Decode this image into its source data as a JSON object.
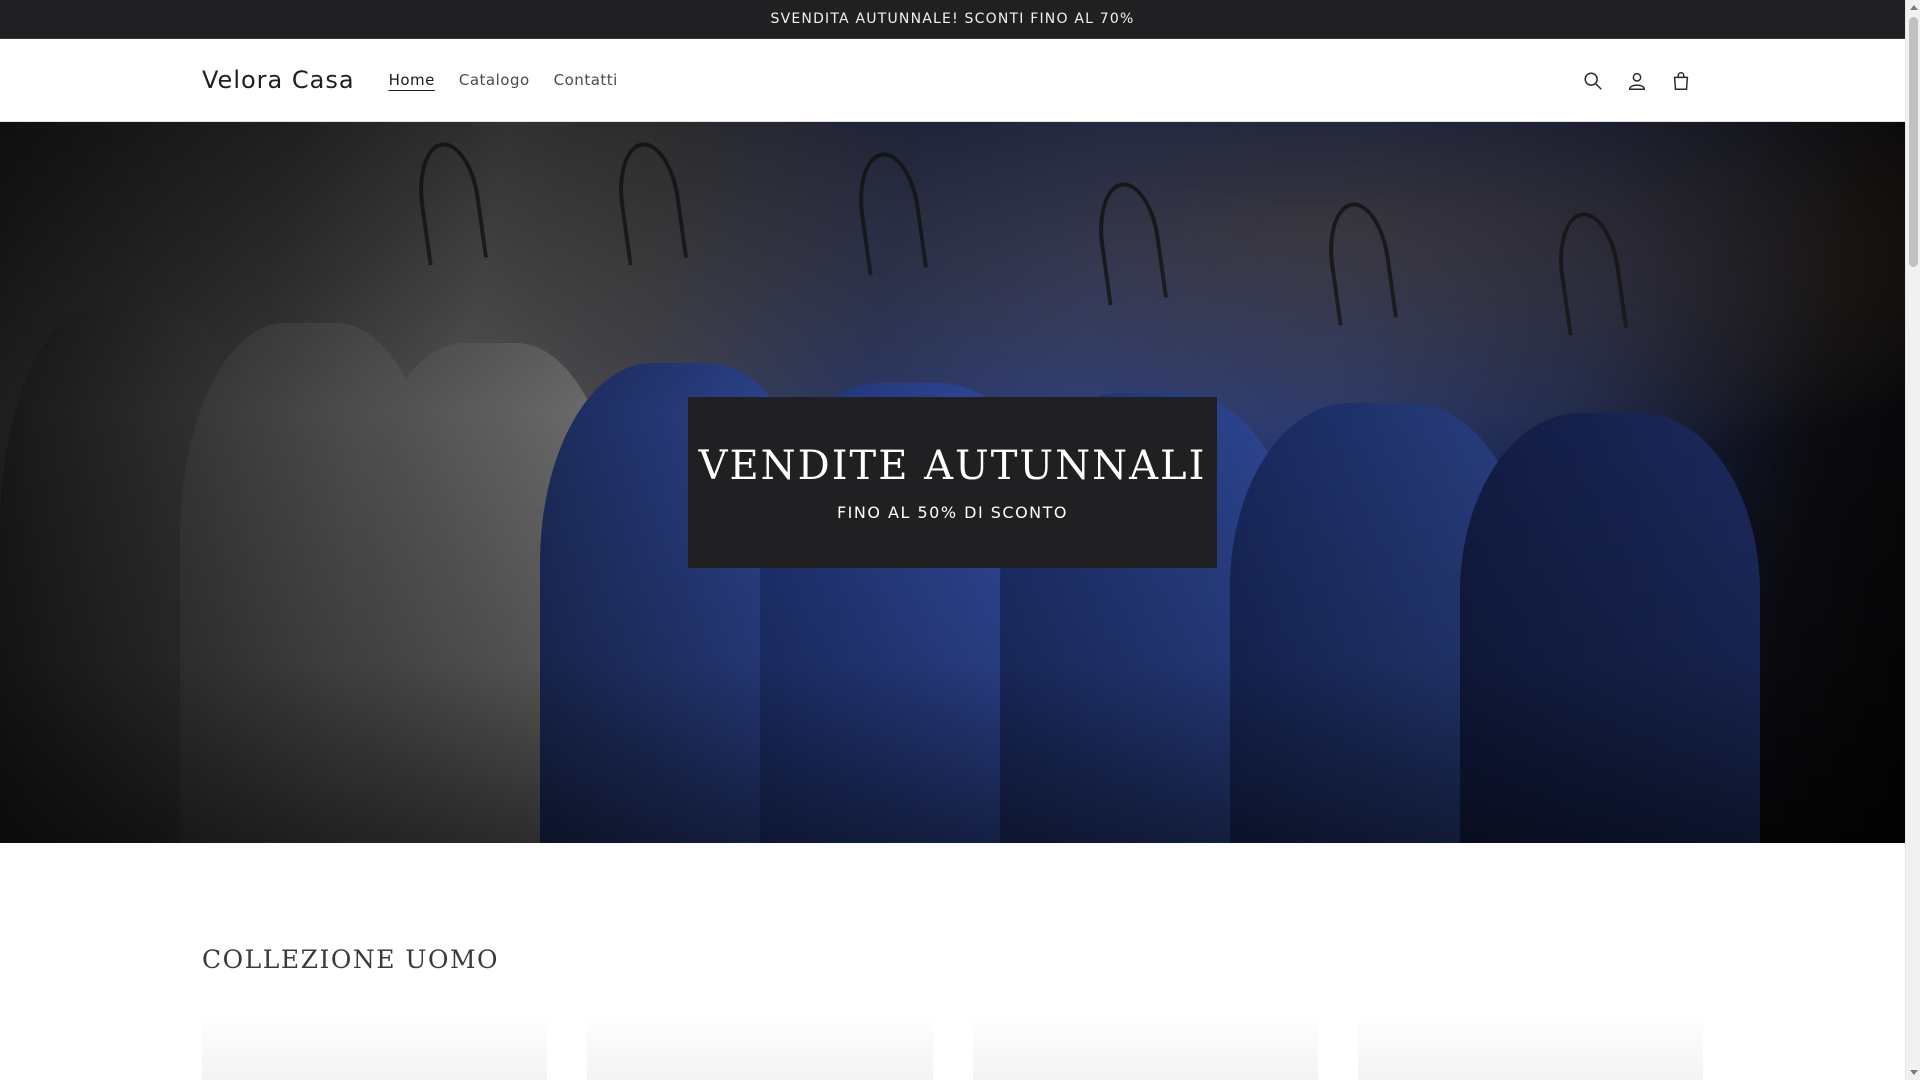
{
  "announcement": {
    "text": "SVENDITA AUTUNNALE! SCONTI FINO AL 70%"
  },
  "header": {
    "logo": "Velora Casa",
    "nav": [
      {
        "label": "Home",
        "active": true
      },
      {
        "label": "Catalogo",
        "active": false
      },
      {
        "label": "Contatti",
        "active": false
      }
    ],
    "icons": [
      "search-icon",
      "account-icon",
      "cart-icon"
    ]
  },
  "hero": {
    "title": "VENDITE AUTUNNALI",
    "subtitle": "FINO AL 50% DI SCONTO"
  },
  "collection": {
    "title": "COLLEZIONE UOMO"
  },
  "colors": {
    "announcement_bg": "#202022",
    "hero_box_bg": "#202022",
    "text_primary": "#121212"
  }
}
